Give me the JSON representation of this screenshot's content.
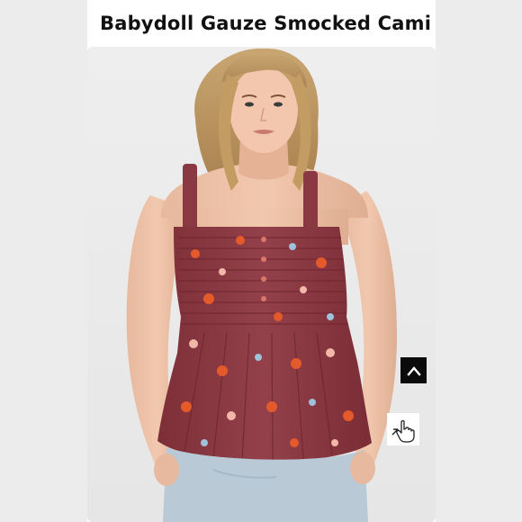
{
  "product": {
    "title": "Babydoll Gauze Smocked Cami"
  },
  "icons": {
    "scroll_top": "chevron-up-icon",
    "interact": "pointing-hand-icon"
  },
  "colors": {
    "page_background": "#ececec",
    "card_background": "#ffffff",
    "top_burgundy": "#8e3a43",
    "floral_orange": "#e45a2b",
    "button_black": "#0b0b0b"
  }
}
